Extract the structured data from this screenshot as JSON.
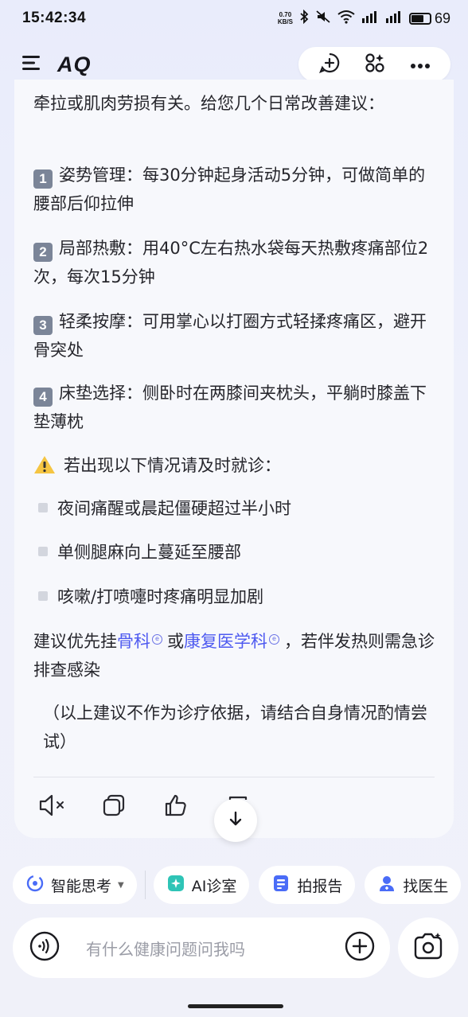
{
  "status_bar": {
    "time": "15:42:34",
    "net_speed_value": "0.70",
    "net_speed_unit": "KB/S",
    "battery": "69",
    "battery_level": 0.69
  },
  "header": {
    "logo": "AQ",
    "icons": [
      "menu-icon",
      "new-chat-icon",
      "apps-icon",
      "more-icon"
    ]
  },
  "message": {
    "intro": "牵拉或肌肉劳损有关。给您几个日常改善建议：",
    "tips": [
      {
        "num": "1",
        "text": "姿势管理：每30分钟起身活动5分钟，可做简单的腰部后仰拉伸"
      },
      {
        "num": "2",
        "text": "局部热敷：用40°C左右热水袋每天热敷疼痛部位2次，每次15分钟"
      },
      {
        "num": "3",
        "text": "轻柔按摩：可用掌心以打圈方式轻揉疼痛区，避开骨突处"
      },
      {
        "num": "4",
        "text": "床垫选择：侧卧时在两膝间夹枕头，平躺时膝盖下垫薄枕"
      }
    ],
    "warning": "若出现以下情况请及时就诊：",
    "bullets": [
      "夜间痛醒或晨起僵硬超过半小时",
      "单侧腿麻向上蔓延至腰部",
      "咳嗽/打喷嚏时疼痛明显加剧"
    ],
    "rec_prefix": "建议优先挂",
    "rec_link1": "骨科",
    "rec_mid": "或",
    "rec_link2": "康复医学科",
    "rec_suffix": "，若伴发热则需急诊排查感染",
    "disclaimer": "（以上建议不作为诊疗依据，请结合自身情况酌情尝试）"
  },
  "actions": [
    "speaker-mute-icon",
    "copy-icon",
    "thumbs-up-icon",
    "share-icon"
  ],
  "chips": [
    {
      "label": "智能思考",
      "icon": "think-icon"
    },
    {
      "label": "AI诊室",
      "icon": "ai-clinic-icon"
    },
    {
      "label": "拍报告",
      "icon": "report-icon"
    },
    {
      "label": "找医生",
      "icon": "doctor-icon"
    }
  ],
  "input": {
    "placeholder": "有什么健康问题问我吗"
  },
  "colors": {
    "accent": "#4e5af0",
    "chip_teal": "#2ec4b6",
    "chip_blue": "#4a6cf7"
  }
}
